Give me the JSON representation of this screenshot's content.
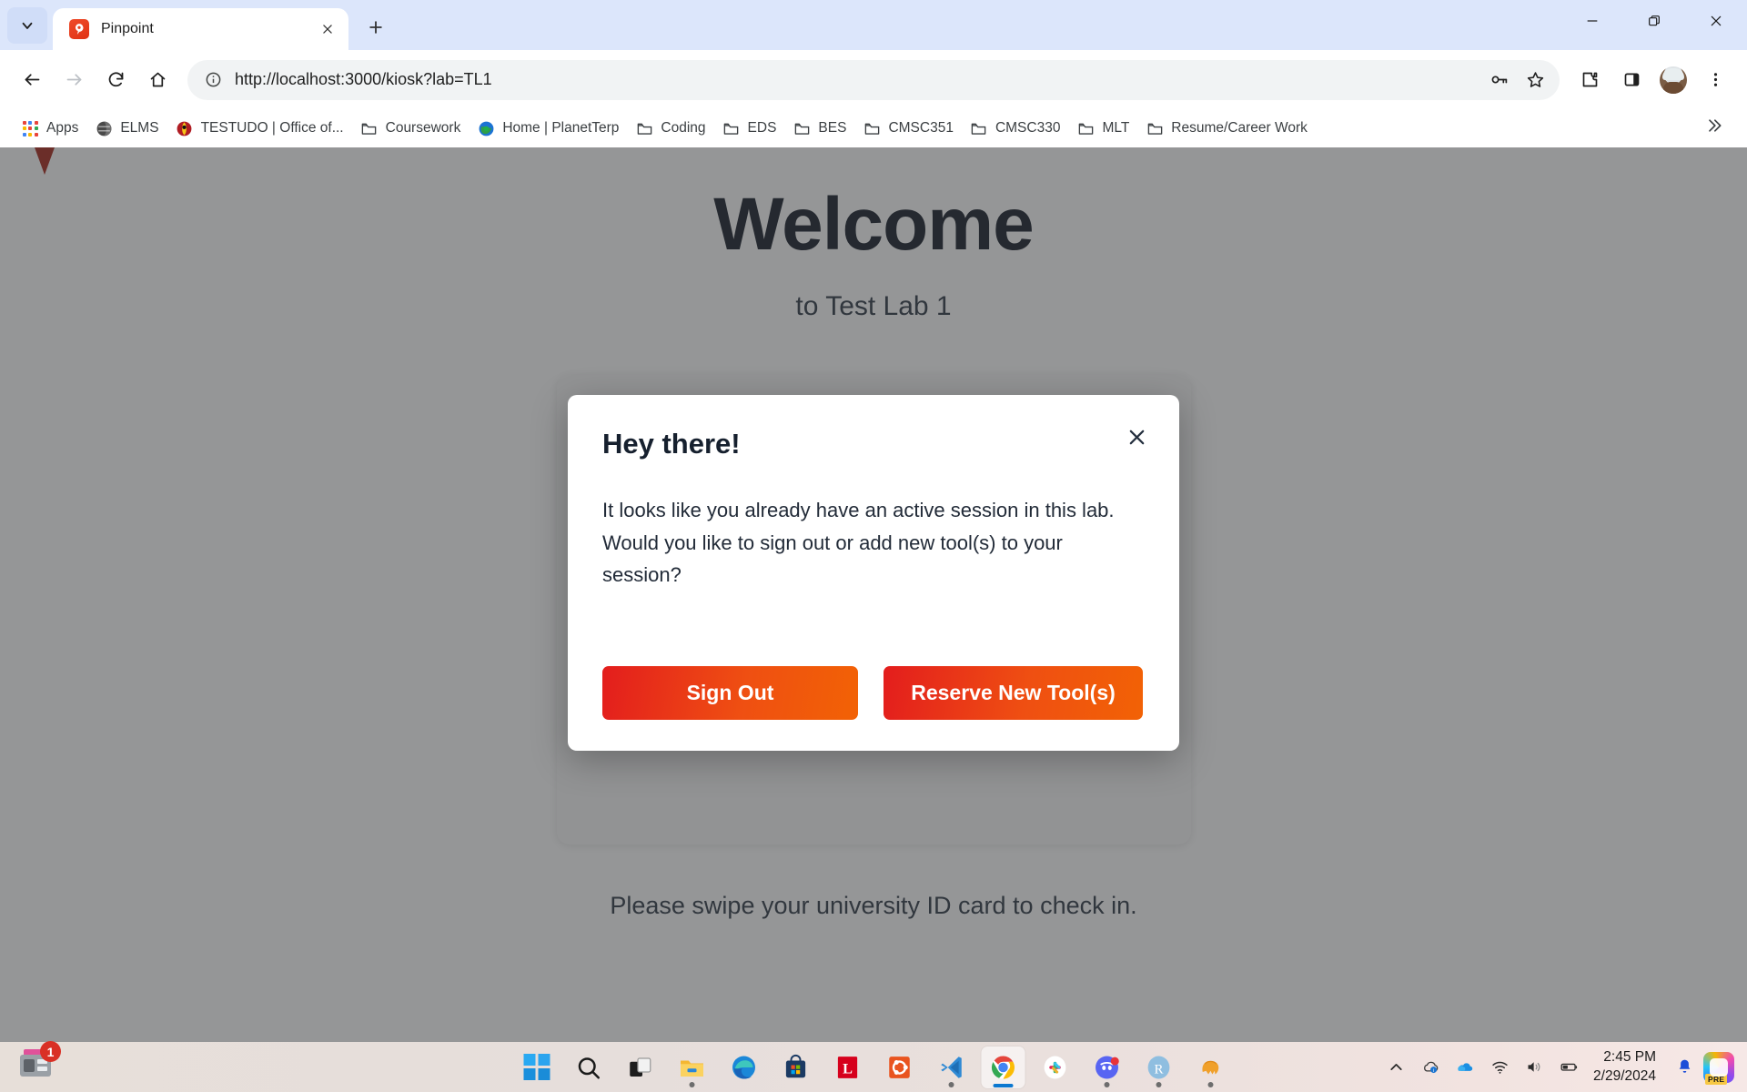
{
  "browser": {
    "tab": {
      "title": "Pinpoint",
      "favicon_icon": "pinpoint-pin-icon"
    },
    "tab_list_icon": "chevron-down-icon",
    "new_tab_icon": "plus-icon",
    "window_controls": {
      "minimize_icon": "minimize-icon",
      "maximize_icon": "restore-icon",
      "close_icon": "close-icon"
    },
    "toolbar": {
      "back_icon": "arrow-left-icon",
      "forward_icon": "arrow-right-icon",
      "reload_icon": "reload-icon",
      "home_icon": "home-icon",
      "site_info_icon": "info-circle-icon",
      "url": "http://localhost:3000/kiosk?lab=TL1",
      "password_icon": "key-icon",
      "bookmark_icon": "star-icon",
      "extensions_icon": "puzzle-icon",
      "side_panel_icon": "side-panel-icon",
      "profile_icon": "avatar",
      "menu_icon": "three-dots-vertical-icon"
    },
    "bookmarks": [
      {
        "label": "Apps",
        "icon": "apps-grid-icon"
      },
      {
        "label": "ELMS",
        "icon": "elms-globe-icon"
      },
      {
        "label": "TESTUDO | Office of...",
        "icon": "testudo-turtle-icon"
      },
      {
        "label": "Coursework",
        "icon": "folder-icon"
      },
      {
        "label": "Home | PlanetTerp",
        "icon": "planetterp-icon"
      },
      {
        "label": "Coding",
        "icon": "folder-icon"
      },
      {
        "label": "EDS",
        "icon": "folder-icon"
      },
      {
        "label": "BES",
        "icon": "folder-icon"
      },
      {
        "label": "CMSC351",
        "icon": "folder-icon"
      },
      {
        "label": "CMSC330",
        "icon": "folder-icon"
      },
      {
        "label": "MLT",
        "icon": "folder-icon"
      },
      {
        "label": "Resume/Career Work",
        "icon": "folder-icon"
      }
    ],
    "bookmarks_overflow_icon": "chevron-double-right-icon"
  },
  "page": {
    "heading": "Welcome",
    "subheading": "to Test Lab 1",
    "footer_note": "Please swipe your university ID card to check in.",
    "logo_icon": "pinpoint-map-pin-logo"
  },
  "modal": {
    "title": "Hey there!",
    "close_icon": "close-icon",
    "body": "It looks like you already have an active session in this lab. Would you like to sign out or add new tool(s) to your session?",
    "primary_button": "Sign Out",
    "secondary_button": "Reserve New Tool(s)",
    "button_gradient_start": "#e31d1d",
    "button_gradient_end": "#f26205"
  },
  "taskbar": {
    "widget_badge": "1",
    "widget_icon": "news-weather-widget-icon",
    "items": [
      {
        "name": "start",
        "icon": "windows-start-icon"
      },
      {
        "name": "search",
        "icon": "search-icon"
      },
      {
        "name": "task-view",
        "icon": "task-view-icon"
      },
      {
        "name": "file-explorer",
        "icon": "file-explorer-icon"
      },
      {
        "name": "edge",
        "icon": "edge-icon"
      },
      {
        "name": "microsoft-store",
        "icon": "microsoft-store-icon"
      },
      {
        "name": "latex",
        "icon": "latex-icon"
      },
      {
        "name": "ubuntu",
        "icon": "ubuntu-icon"
      },
      {
        "name": "vs-code",
        "icon": "vscode-icon"
      },
      {
        "name": "chrome",
        "icon": "chrome-icon"
      },
      {
        "name": "slack",
        "icon": "slack-icon"
      },
      {
        "name": "discord",
        "icon": "discord-icon"
      },
      {
        "name": "rstudio",
        "icon": "rstudio-icon"
      },
      {
        "name": "postgresql",
        "icon": "postgresql-elephant-icon"
      }
    ],
    "tray": {
      "overflow_icon": "chevron-up-icon",
      "onedrive_sync_icon": "cloud-sync-icon",
      "onedrive_icon": "onedrive-icon",
      "wifi_icon": "wifi-icon",
      "volume_icon": "speaker-icon",
      "battery_icon": "battery-icon",
      "time": "2:45 PM",
      "date": "2/29/2024",
      "notifications_icon": "bell-icon",
      "copilot_icon": "copilot-icon",
      "copilot_badge": "PRE"
    }
  }
}
